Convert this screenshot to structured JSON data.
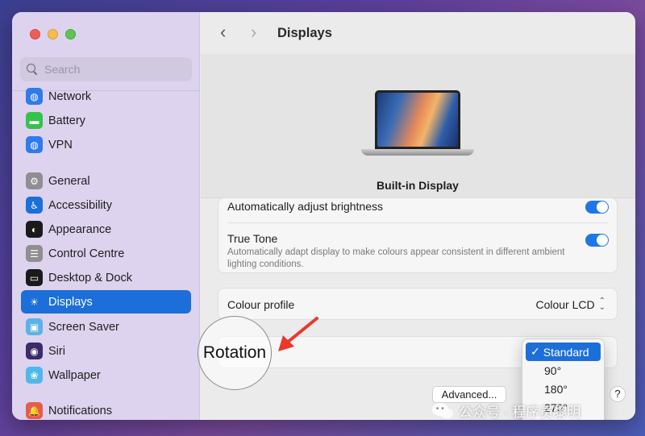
{
  "window": {
    "title": "Displays"
  },
  "search": {
    "placeholder": "Search"
  },
  "sidebar": {
    "items": [
      {
        "label": "Network",
        "icon": "globe-icon",
        "color": "#2f7bea"
      },
      {
        "label": "Battery",
        "icon": "battery-icon",
        "color": "#35c24a"
      },
      {
        "label": "VPN",
        "icon": "globe-icon",
        "color": "#2f7bea"
      },
      {
        "label": "General",
        "icon": "gear-icon",
        "color": "#8e8e93"
      },
      {
        "label": "Accessibility",
        "icon": "accessibility-icon",
        "color": "#1c6fd8"
      },
      {
        "label": "Appearance",
        "icon": "appearance-icon",
        "color": "#1a1a1a"
      },
      {
        "label": "Control Centre",
        "icon": "control-centre-icon",
        "color": "#8e8e93"
      },
      {
        "label": "Desktop & Dock",
        "icon": "dock-icon",
        "color": "#1a1a1a"
      },
      {
        "label": "Displays",
        "icon": "sun-icon",
        "color": "#1c6fd8"
      },
      {
        "label": "Screen Saver",
        "icon": "screen-saver-icon",
        "color": "#5ab3e6"
      },
      {
        "label": "Siri",
        "icon": "siri-icon",
        "color": "#3a2b6a"
      },
      {
        "label": "Wallpaper",
        "icon": "flower-icon",
        "color": "#4fb8e8"
      },
      {
        "label": "Notifications",
        "icon": "bell-icon",
        "color": "#e85a4f"
      }
    ]
  },
  "hero": {
    "display_name": "Built-in Display"
  },
  "settings": {
    "auto_brightness": {
      "label": "Automatically adjust brightness",
      "on": true
    },
    "true_tone": {
      "label": "True Tone",
      "description": "Automatically adapt display to make colours appear consistent in different ambient lighting conditions.",
      "on": true
    },
    "colour_profile": {
      "label": "Colour profile",
      "value": "Colour LCD"
    },
    "rotation": {
      "label": "Rotation"
    }
  },
  "dropdown": {
    "options": [
      "Standard",
      "90°",
      "180°",
      "270°"
    ],
    "selected": "Standard"
  },
  "buttons": {
    "advanced": "Advanced...",
    "help": "?"
  },
  "watermark": {
    "text": "公众号 · 程序员黎明"
  },
  "colors": {
    "accent": "#1c6fd8",
    "toggle_on": "#1e77e6",
    "annotation": "#e8392b"
  }
}
